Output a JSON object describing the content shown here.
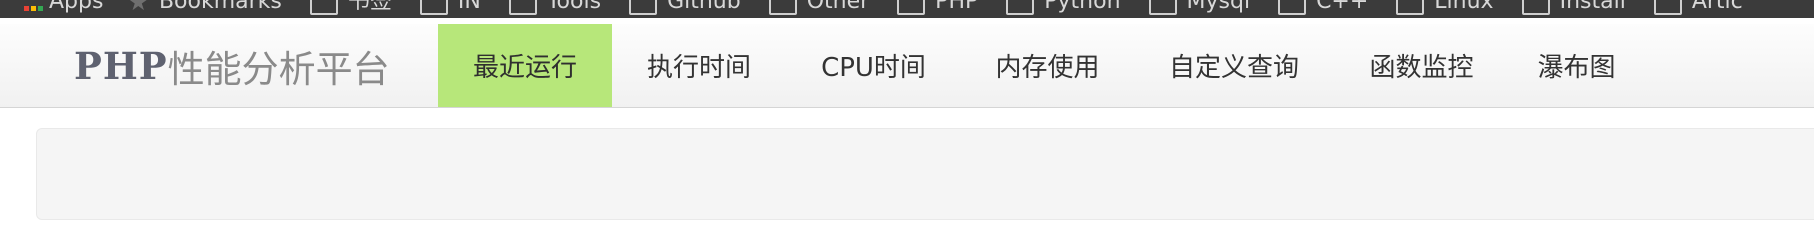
{
  "bookmarks_bar": {
    "items": [
      {
        "label": "Apps",
        "icon": "apps-grid-icon"
      },
      {
        "label": "Bookmarks",
        "icon": "star-icon"
      },
      {
        "label": "书签",
        "icon": "folder-icon"
      },
      {
        "label": "IN",
        "icon": "folder-icon"
      },
      {
        "label": "Tools",
        "icon": "folder-icon"
      },
      {
        "label": "Github",
        "icon": "folder-icon"
      },
      {
        "label": "Other",
        "icon": "folder-icon"
      },
      {
        "label": "PHP",
        "icon": "folder-icon"
      },
      {
        "label": "Python",
        "icon": "folder-icon"
      },
      {
        "label": "Mysql",
        "icon": "folder-icon"
      },
      {
        "label": "C++",
        "icon": "folder-icon"
      },
      {
        "label": "Linux",
        "icon": "folder-icon"
      },
      {
        "label": "Install",
        "icon": "folder-icon"
      },
      {
        "label": "Artic",
        "icon": "folder-icon"
      }
    ]
  },
  "brand": {
    "strong": "PHP",
    "light": "性能分析平台"
  },
  "nav": {
    "items": [
      {
        "label": "最近运行",
        "active": true
      },
      {
        "label": "执行时间",
        "active": false
      },
      {
        "label": "CPU时间",
        "active": false
      },
      {
        "label": "内存使用",
        "active": false
      },
      {
        "label": "自定义查询",
        "active": false
      },
      {
        "label": "函数监控",
        "active": false
      },
      {
        "label": "瀑布图",
        "active": false
      }
    ]
  },
  "colors": {
    "active_tab": "#b7e77a",
    "bookmarks_bg": "#3b3b3b",
    "navbar_bg": "#f5f5f5",
    "brand_text": "#5f6270"
  }
}
